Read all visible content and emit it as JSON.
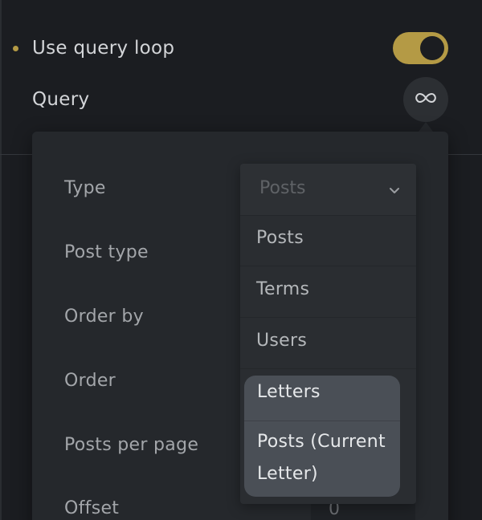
{
  "loop_row": {
    "label": "Use query loop",
    "enabled": true,
    "accent_color": "#b49a45"
  },
  "query_row": {
    "label": "Query",
    "icon": "infinity-icon"
  },
  "popover": {
    "fields": {
      "type": "Type",
      "post_type": "Post type",
      "order_by": "Order by",
      "order": "Order",
      "posts_per_page": "Posts per page",
      "offset": "Offset"
    },
    "offset_value": "0",
    "type_select": {
      "current_value": "Posts",
      "chevron_icon": "chevron-down-icon",
      "options": [
        "Posts",
        "Terms",
        "Users",
        "Letters",
        "Posts (Current Letter)"
      ],
      "hovered_options": [
        "Letters",
        "Posts (Current Letter)"
      ]
    }
  }
}
